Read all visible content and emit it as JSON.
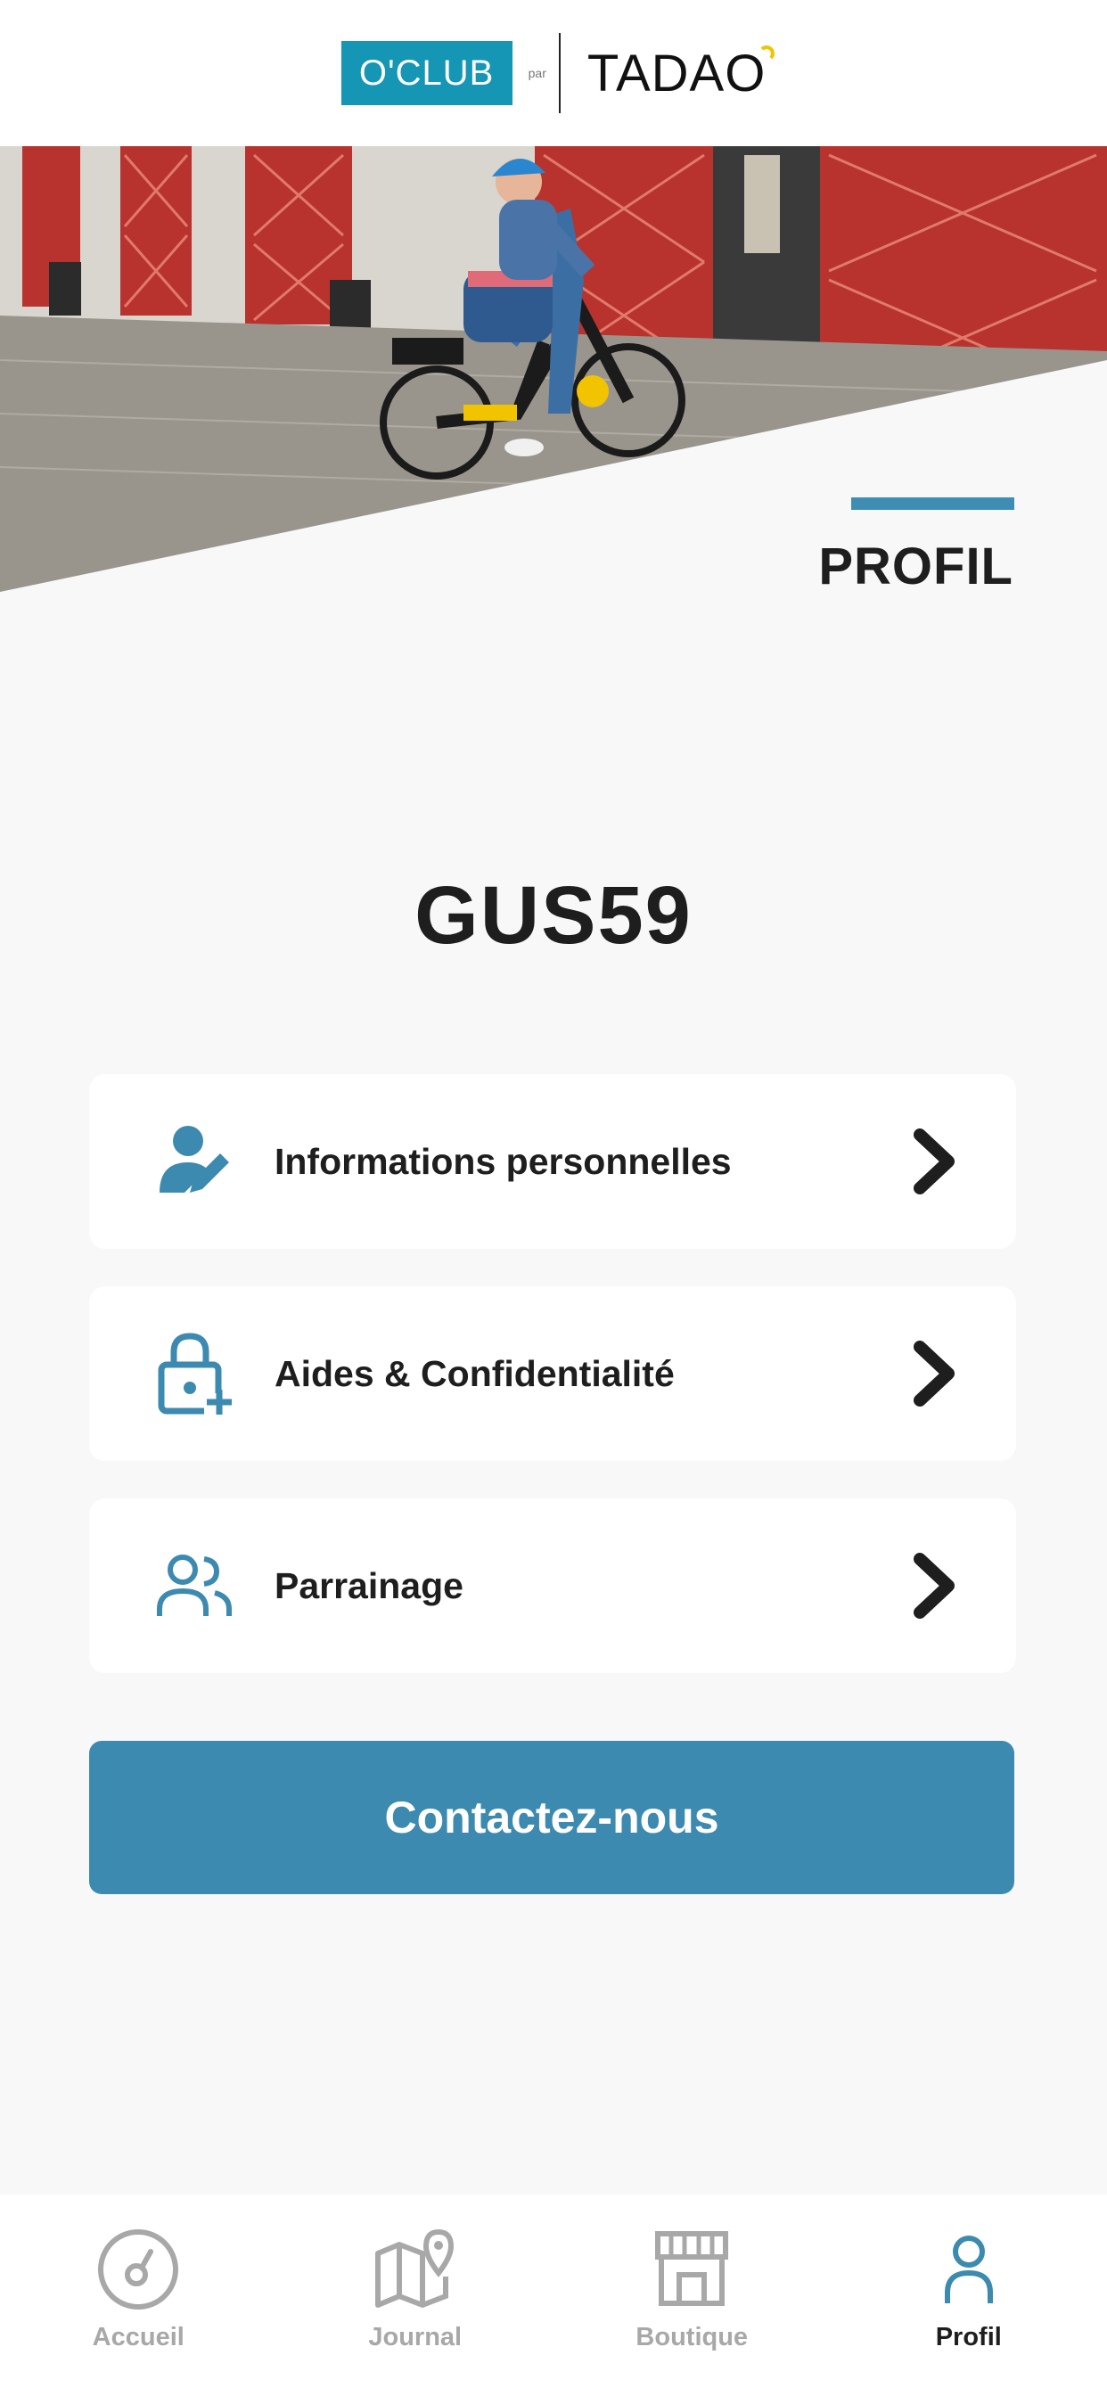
{
  "header": {
    "logo_left": "O'CLUB",
    "logo_par": "par",
    "logo_right": "TADAO"
  },
  "page": {
    "title": "PROFIL",
    "username": "GUS59"
  },
  "menu": [
    {
      "label": "Informations personnelles",
      "icon": "user-edit-icon"
    },
    {
      "label": "Aides & Confidentialité",
      "icon": "lock-plus-icon"
    },
    {
      "label": "Parrainage",
      "icon": "users-icon"
    }
  ],
  "contact_button": "Contactez-nous",
  "bottom_nav": [
    {
      "label": "Accueil",
      "icon": "gauge-icon",
      "active": false
    },
    {
      "label": "Journal",
      "icon": "map-pin-icon",
      "active": false
    },
    {
      "label": "Boutique",
      "icon": "store-icon",
      "active": false
    },
    {
      "label": "Profil",
      "icon": "user-icon",
      "active": true
    }
  ],
  "colors": {
    "brand_blue": "#3d8ab0",
    "logo_blue": "#1596b4",
    "accent_yellow": "#f2c400",
    "text_dark": "#1e1e1e",
    "nav_inactive": "#a8a8a8"
  }
}
